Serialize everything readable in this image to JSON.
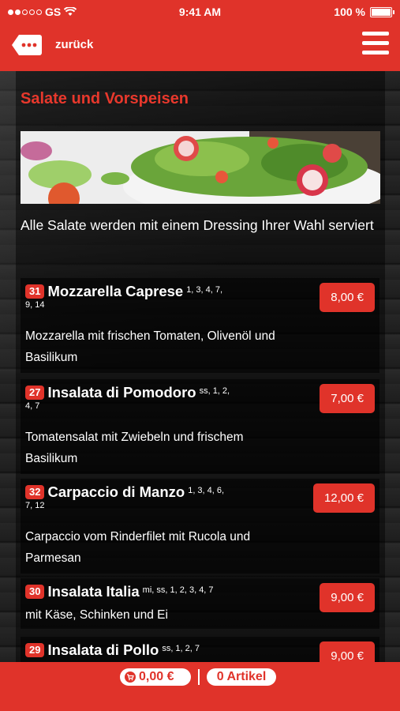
{
  "status": {
    "carrier": "GS",
    "time": "9:41 AM",
    "battery": "100 %"
  },
  "nav": {
    "back_label": "zurück"
  },
  "section": {
    "title": "Salate und Vorspeisen",
    "intro": "Alle Salate werden mit einem Dressing Ihrer Wahl serviert"
  },
  "items": [
    {
      "number": "31",
      "name": "Mozzarella Caprese",
      "allergens_1": "1, 3, 4, 7,",
      "allergens_2": "9, 14",
      "description": "Mozzarella mit frischen Tomaten, Olivenöl und Basilikum",
      "price": "8,00 €"
    },
    {
      "number": "27",
      "name": "Insalata di Pomodoro",
      "allergens_1": "ss, 1, 2,",
      "allergens_2": "4, 7",
      "description": "Tomatensalat mit Zwiebeln und frischem Basilikum",
      "price": "7,00 €"
    },
    {
      "number": "32",
      "name": "Carpaccio di Manzo",
      "allergens_1": "1, 3, 4, 6,",
      "allergens_2": "7, 12",
      "description": "Carpaccio vom Rinderfilet mit Rucola und Parmesan",
      "price": "12,00 €"
    },
    {
      "number": "30",
      "name": "Insalata Italia",
      "allergens_1": "mi, ss, 1, 2, 3, 4, 7",
      "allergens_2": "",
      "description": "mit Käse, Schinken und Ei",
      "price": "9,00 €"
    },
    {
      "number": "29",
      "name": "Insalata di Pollo",
      "allergens_1": "ss, 1, 2, 7",
      "allergens_2": "",
      "description": "",
      "price": "9,00 €"
    }
  ],
  "cart": {
    "total": "0,00 €",
    "items_label": "0 Artikel"
  },
  "colors": {
    "accent": "#e0332a"
  }
}
